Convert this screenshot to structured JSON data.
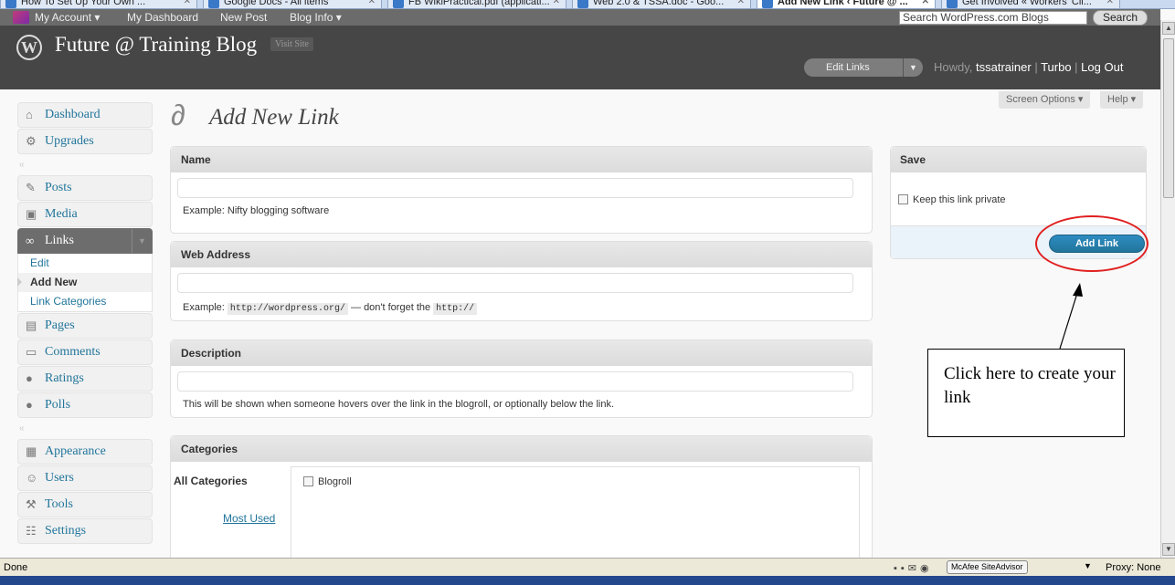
{
  "browser": {
    "tabs": [
      {
        "label": "How To Set Up Your Own ...",
        "active": false
      },
      {
        "label": "Google Docs - All items",
        "active": false
      },
      {
        "label": "FB WikiPractical.pdf (applicati...",
        "active": false
      },
      {
        "label": "Web 2.0 & TSSA.doc - Goo...",
        "active": false
      },
      {
        "label": "Add New Link ‹ Future @ ...",
        "active": true
      },
      {
        "label": "Get Involved « Workers' Cli...",
        "active": false
      }
    ],
    "status_text": "Done",
    "mcafee_label": "McAfee SiteAdvisor",
    "proxy_label": "Proxy: None"
  },
  "adminbar": {
    "items": [
      "My Account ▾",
      "My Dashboard",
      "New Post",
      "Blog Info ▾"
    ],
    "search_placeholder": "Search WordPress.com Blogs",
    "search_button": "Search"
  },
  "header": {
    "site_title": "Future @ Training Blog",
    "visit_site": "Visit Site",
    "edit_links": "Edit Links",
    "howdy_prefix": "Howdy, ",
    "username": "tssatrainer",
    "turbo": "Turbo",
    "logout": "Log Out"
  },
  "screen_options": {
    "label": "Screen Options ▾",
    "help": "Help ▾"
  },
  "menu": {
    "dashboard": "Dashboard",
    "upgrades": "Upgrades",
    "posts": "Posts",
    "media": "Media",
    "links": "Links",
    "links_sub": [
      "Edit",
      "Add New",
      "Link Categories"
    ],
    "pages": "Pages",
    "comments": "Comments",
    "ratings": "Ratings",
    "polls": "Polls",
    "appearance": "Appearance",
    "users": "Users",
    "tools": "Tools",
    "settings": "Settings"
  },
  "page": {
    "title": "Add New Link",
    "name_box": {
      "title": "Name",
      "value": "",
      "help": "Example: Nifty blogging software"
    },
    "web_box": {
      "title": "Web Address",
      "value": "",
      "help_prefix": "Example: ",
      "help_code1": "http://wordpress.org/",
      "help_mid": " — don't forget the ",
      "help_code2": "http://"
    },
    "desc_box": {
      "title": "Description",
      "value": "",
      "help": "This will be shown when someone hovers over the link in the blogroll, or optionally below the link."
    },
    "cat_box": {
      "title": "Categories",
      "tab_all": "All Categories",
      "tab_used": "Most Used",
      "items": [
        "Blogroll"
      ]
    },
    "save_box": {
      "title": "Save",
      "private_label": "Keep this link private",
      "button": "Add Link"
    }
  },
  "annotation": {
    "text": "Click here to create your link",
    "color": "#e02020"
  }
}
